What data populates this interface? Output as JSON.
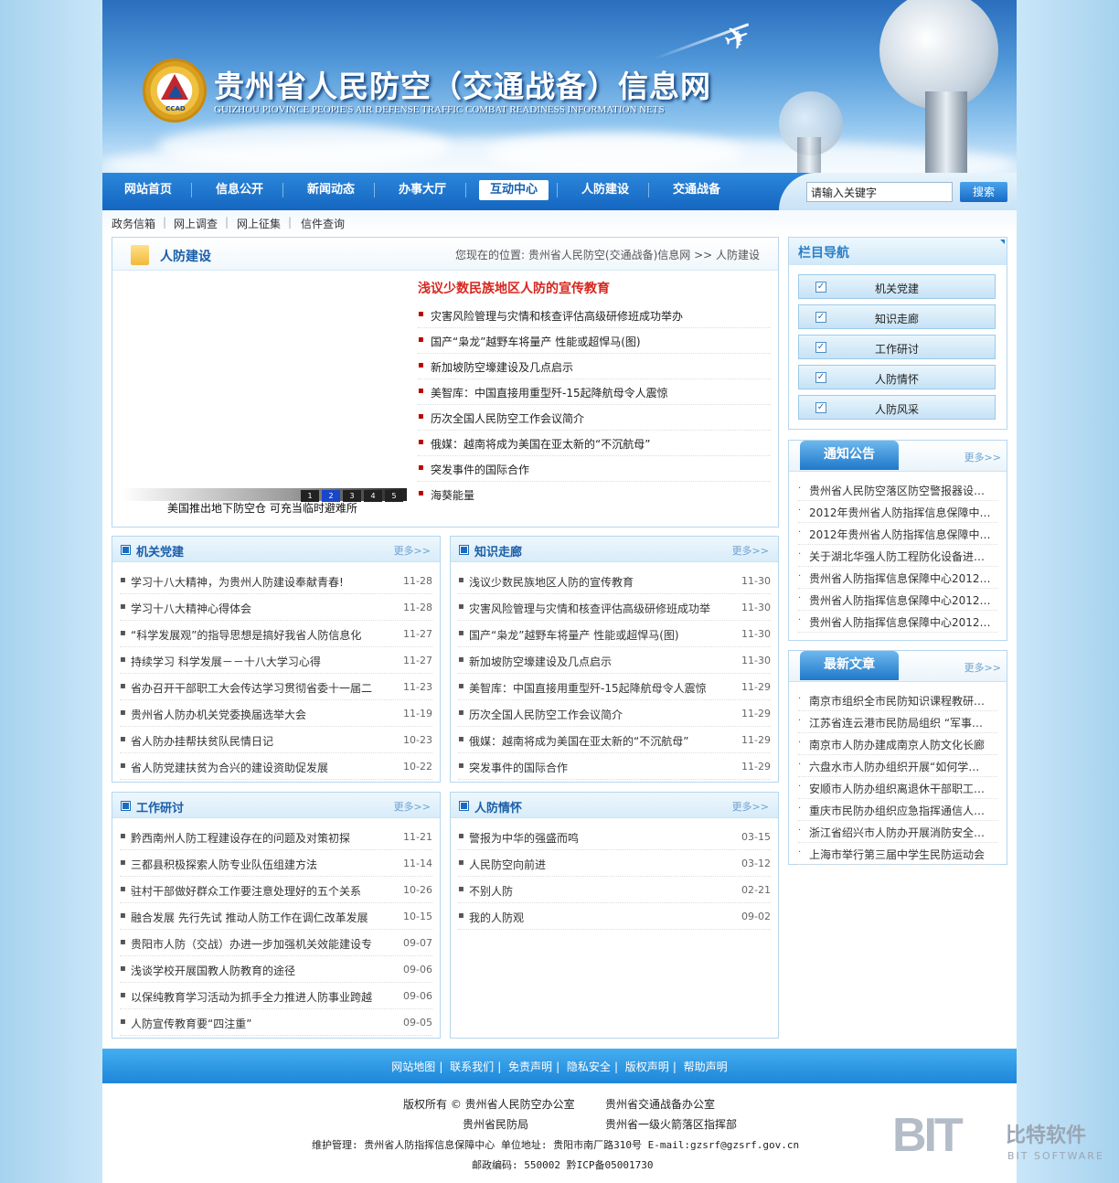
{
  "header": {
    "title": "贵州省人民防空（交通战备）信息网",
    "subtitle": "GUIZHOU PIOVINCE PEOPIE'S AIR DEFENSE TRAFFIC COMBAT READINESS INFORMATION NETS",
    "logo_text": "CCAD"
  },
  "nav": {
    "items": [
      "网站首页",
      "信息公开",
      "新闻动态",
      "办事大厅",
      "互动中心",
      "人防建设",
      "交通战备"
    ],
    "active_index": 4,
    "search_placeholder": "请输入关键字",
    "search_value": "请输入关键字",
    "search_button": "搜索"
  },
  "subnav": {
    "items": [
      "政务信箱",
      "网上调查",
      "网上征集",
      "信件查询"
    ]
  },
  "feature": {
    "title": "人防建设",
    "breadcrumb": "您现在的位置: 贵州省人民防空(交通战备)信息网 >> 人防建设",
    "slider_pages": [
      "1",
      "2",
      "3",
      "4",
      "5"
    ],
    "slider_active": "2",
    "slider_caption": "美国推出地下防空仓 可充当临时避难所",
    "headline": "浅议少数民族地区人防的宣传教育",
    "items": [
      "灾害风险管理与灾情和核查评估高级研修班成功举办",
      "国产“枭龙”越野车将量产 性能或超悍马(图)",
      "新加坡防空壕建设及几点启示",
      "美智库：中国直接用重型歼-15起降航母令人震惊",
      "历次全国人民防空工作会议简介",
      "俄媒：越南将成为美国在亚太新的“不沉航母”",
      "突发事件的国际合作",
      "海葵能量"
    ]
  },
  "panels": {
    "more_label": "更多>>",
    "jiguan": {
      "title": "机关党建",
      "rows": [
        {
          "text": "学习十八大精神，为贵州人防建设奉献青春!",
          "date": "11-28"
        },
        {
          "text": "学习十八大精神心得体会",
          "date": "11-28"
        },
        {
          "text": "“科学发展观”的指导思想是搞好我省人防信息化",
          "date": "11-27"
        },
        {
          "text": "持续学习 科学发展－－十八大学习心得",
          "date": "11-27"
        },
        {
          "text": "省办召开干部职工大会传达学习贯彻省委十一届二",
          "date": "11-23"
        },
        {
          "text": "贵州省人防办机关党委换届选举大会",
          "date": "11-19"
        },
        {
          "text": "省人防办挂帮扶贫队民情日记",
          "date": "10-23"
        },
        {
          "text": "省人防党建扶贫为合兴的建设资助促发展",
          "date": "10-22"
        }
      ]
    },
    "zhishi": {
      "title": "知识走廊",
      "rows": [
        {
          "text": "浅议少数民族地区人防的宣传教育",
          "date": "11-30"
        },
        {
          "text": "灾害风险管理与灾情和核查评估高级研修班成功举",
          "date": "11-30"
        },
        {
          "text": "国产“枭龙”越野车将量产 性能或超悍马(图)",
          "date": "11-30"
        },
        {
          "text": "新加坡防空壕建设及几点启示",
          "date": "11-30"
        },
        {
          "text": "美智库：中国直接用重型歼-15起降航母令人震惊",
          "date": "11-29"
        },
        {
          "text": "历次全国人民防空工作会议简介",
          "date": "11-29"
        },
        {
          "text": "俄媒：越南将成为美国在亚太新的“不沉航母”",
          "date": "11-29"
        },
        {
          "text": "突发事件的国际合作",
          "date": "11-29"
        }
      ]
    },
    "gongzuo": {
      "title": "工作研讨",
      "rows": [
        {
          "text": "黔西南州人防工程建设存在的问题及对策初探",
          "date": "11-21"
        },
        {
          "text": "三都县积极探索人防专业队伍组建方法",
          "date": "11-14"
        },
        {
          "text": "驻村干部做好群众工作要注意处理好的五个关系",
          "date": "10-26"
        },
        {
          "text": "融合发展 先行先试 推动人防工作在调仁改革发展",
          "date": "10-15"
        },
        {
          "text": "贵阳市人防（交战）办进一步加强机关效能建设专",
          "date": "09-07"
        },
        {
          "text": "浅谈学校开展国教人防教育的途径",
          "date": "09-06"
        },
        {
          "text": "以保纯教育学习活动为抓手全力推进人防事业跨越",
          "date": "09-06"
        },
        {
          "text": "人防宣传教育要“四注重”",
          "date": "09-05"
        }
      ]
    },
    "qinghuai": {
      "title": "人防情怀",
      "rows": [
        {
          "text": "警报为中华的强盛而鸣",
          "date": "03-15"
        },
        {
          "text": "人民防空向前进",
          "date": "03-12"
        },
        {
          "text": "不别人防",
          "date": "02-21"
        },
        {
          "text": "我的人防观",
          "date": "09-02"
        }
      ]
    }
  },
  "sidebar": {
    "nav_title": "栏目导航",
    "nav_items": [
      "机关党建",
      "知识走廊",
      "工作研讨",
      "人防情怀",
      "人防风采"
    ],
    "notice": {
      "title": "通知公告",
      "more": "更多>>",
      "items": [
        "贵州省人民防空落区防空警报器设…",
        "2012年贵州省人防指挥信息保障中…",
        "2012年贵州省人防指挥信息保障中…",
        "关于湖北华强人防工程防化设备进…",
        "贵州省人防指挥信息保障中心2012…",
        "贵州省人防指挥信息保障中心2012…",
        "贵州省人防指挥信息保障中心2012…"
      ]
    },
    "latest": {
      "title": "最新文章",
      "more": "更多>>",
      "items": [
        "南京市组织全市民防知识课程教研…",
        "江苏省连云港市民防局组织 “军事…",
        "南京市人防办建成南京人防文化长廊",
        "六盘水市人防办组织开展“如何学…",
        "安顺市人防办组织离退休干部职工…",
        "重庆市民防办组织应急指挥通信人…",
        "浙江省绍兴市人防办开展消防安全…",
        "上海市举行第三届中学生民防运动会"
      ]
    }
  },
  "footer": {
    "links": [
      "网站地图",
      "联系我们",
      "免责声明",
      "隐私安全",
      "版权声明",
      "帮助声明"
    ],
    "copyright_1a": "版权所有 © 贵州省人民防空办公室",
    "copyright_1b": "贵州省交通战备办公室",
    "copyright_2a": "贵州省民防局",
    "copyright_2b": "贵州省一级火箭落区指挥部",
    "maintainer": "维护管理: 贵州省人防指挥信息保障中心 单位地址: 贵阳市南厂路310号 E-mail:gzsrf@gzsrf.gov.cn",
    "postcode": "邮政编码: 550002 黔ICP备05001730"
  },
  "watermark": {
    "logo": "BIT",
    "cn": "比特软件",
    "en": "BIT SOFTWARE"
  }
}
